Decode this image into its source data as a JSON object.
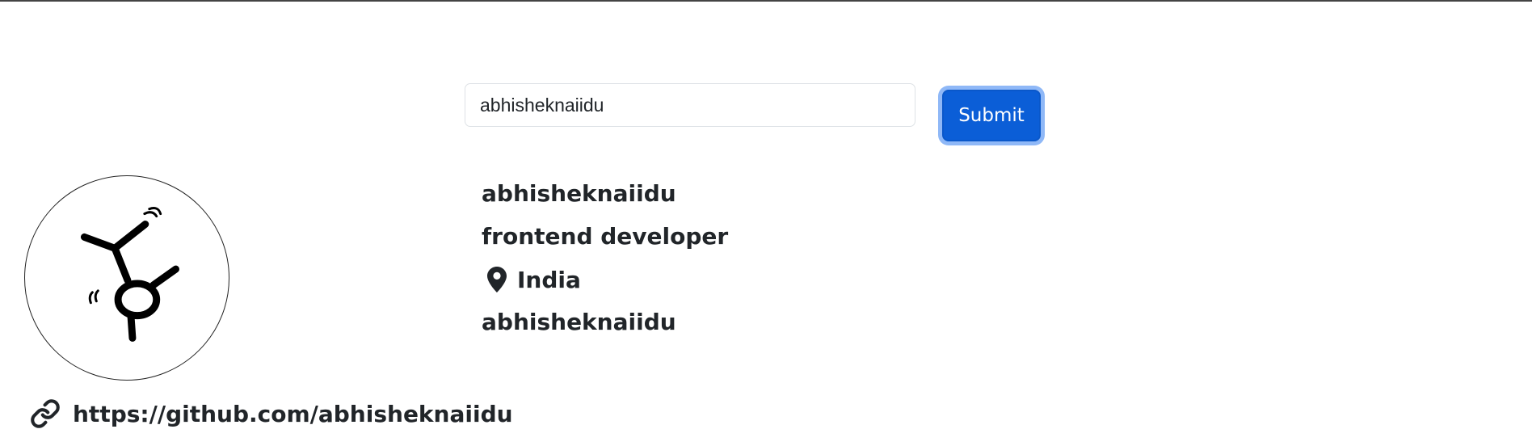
{
  "search": {
    "value": "abhisheknaiidu"
  },
  "actions": {
    "submit_label": "Submit"
  },
  "profile": {
    "name": "abhisheknaiidu",
    "bio": "frontend developer",
    "location": "India",
    "login": "abhisheknaiidu",
    "blog_url": "https://github.com/abhisheknaiidu",
    "avatar_icon": "stick-figure-avatar",
    "location_icon": "map-pin-icon",
    "link_icon": "link-icon"
  },
  "colors": {
    "primary_button": "#0b5ed7",
    "focus_ring": "#8fb8f7",
    "text": "#212529"
  }
}
